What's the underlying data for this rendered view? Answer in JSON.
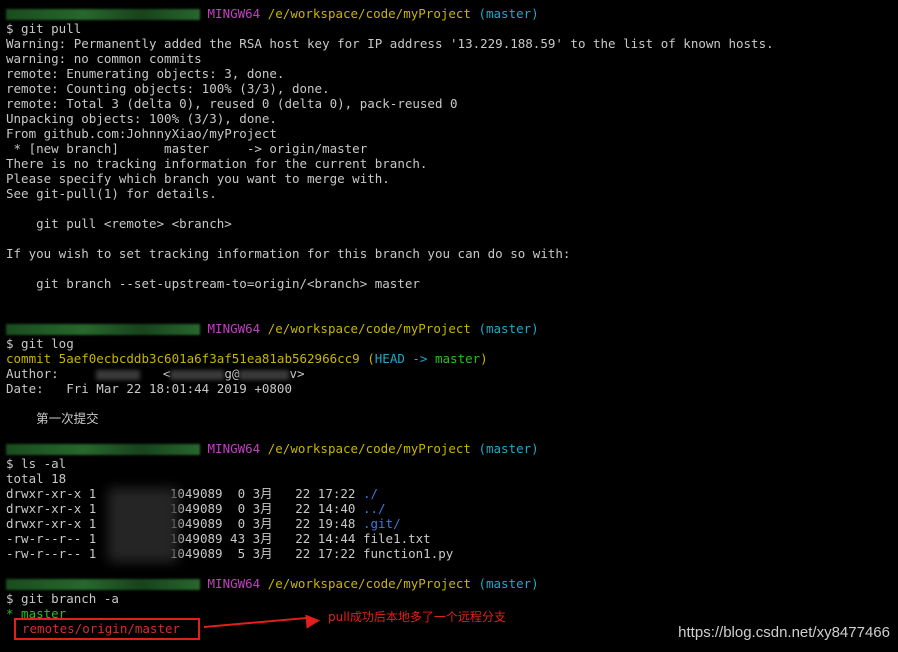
{
  "colors": {
    "prompt": "#26c026",
    "mingw": "#c040c0",
    "path": "#c8b400",
    "branch": "#20a8c8",
    "error": "#d23030",
    "dir": "#3a7ae0"
  },
  "prompt": {
    "mingw": "MINGW64",
    "path": "/e/workspace/code/myProject",
    "branch": "(master)"
  },
  "pull": {
    "cmd": "$ git pull",
    "lines": [
      "Warning: Permanently added the RSA host key for IP address '13.229.188.59' to the list of known hosts.",
      "warning: no common commits",
      "remote: Enumerating objects: 3, done.",
      "remote: Counting objects: 100% (3/3), done.",
      "remote: Total 3 (delta 0), reused 0 (delta 0), pack-reused 0",
      "Unpacking objects: 100% (3/3), done.",
      "From github.com:JohnnyXiao/myProject",
      " * [new branch]      master     -> origin/master",
      "There is no tracking information for the current branch.",
      "Please specify which branch you want to merge with.",
      "See git-pull(1) for details.",
      "",
      "    git pull <remote> <branch>",
      "",
      "If you wish to set tracking information for this branch you can do so with:",
      "",
      "    git branch --set-upstream-to=origin/<branch> master",
      ""
    ]
  },
  "log": {
    "cmd": "$ git log",
    "commit_prefix": "commit 5aef0ecbcddb3c601a6f3af51ea81ab562966cc9",
    "head_open": " (",
    "head": "HEAD -> ",
    "head_branch": "master",
    "head_close": ")",
    "author": "Author:     ",
    "author_mid": "   <",
    "author_at": "g@",
    "author_end": "v>",
    "date": "Date:   Fri Mar 22 18:01:44 2019 +0800",
    "message": "    第一次提交"
  },
  "ls": {
    "cmd": "$ ls -al",
    "total": "total 18",
    "rows": [
      {
        "pre": "drwxr-xr-x 1 ",
        "mid": "1049089  0 3月   22 17:22 ",
        "name": "./"
      },
      {
        "pre": "drwxr-xr-x 1 ",
        "mid": "1049089  0 3月   22 14:40 ",
        "name": "../"
      },
      {
        "pre": "drwxr-xr-x 1 ",
        "mid": "1049089  0 3月   22 19:48 ",
        "name": ".git/"
      },
      {
        "pre": "-rw-r--r-- 1 ",
        "mid": "1049089 43 3月   22 14:44 ",
        "name": "file1.txt"
      },
      {
        "pre": "-rw-r--r-- 1 ",
        "mid": "1049089  5 3月   22 17:22 ",
        "name": "function1.py"
      }
    ]
  },
  "branch": {
    "cmd": "$ git branch -a",
    "current": "* master",
    "remote": "remotes/origin/master"
  },
  "annotation": "pull成功后本地多了一个远程分支",
  "watermark": "https://blog.csdn.net/xy8477466"
}
